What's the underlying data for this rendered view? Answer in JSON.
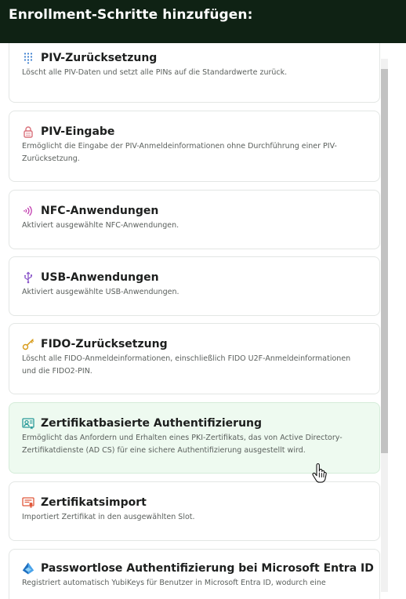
{
  "header": {
    "title": "Enrollment-Schritte hinzufügen:"
  },
  "steps": [
    {
      "icon": "keypad-icon",
      "title": "PIV-Zurücksetzung",
      "description": "Löscht alle PIV-Daten und setzt alle PINs auf die Standardwerte zurück."
    },
    {
      "icon": "lock-icon",
      "title": "PIV-Eingabe",
      "description": "Ermöglicht die Eingabe der PIV-Anmeldeinformationen ohne Durchführung einer PIV-Zurücksetzung."
    },
    {
      "icon": "nfc-icon",
      "title": "NFC-Anwendungen",
      "description": "Aktiviert ausgewählte NFC-Anwendungen."
    },
    {
      "icon": "usb-icon",
      "title": "USB-Anwendungen",
      "description": "Aktiviert ausgewählte USB-Anwendungen."
    },
    {
      "icon": "key-icon",
      "title": "FIDO-Zurücksetzung",
      "description": "Löscht alle FIDO-Anmeldeinformationen, einschließlich FIDO U2F-Anmeldeinformationen und die FIDO2-PIN."
    },
    {
      "icon": "certificate-icon",
      "title": "Zertifikatbasierte Authentifizierung",
      "description": "Ermöglicht das Anfordern und Erhalten eines PKI-Zertifikats, das von Active Directory-Zertifikatdienste (AD CS) für eine sichere Authentifizierung ausgestellt wird."
    },
    {
      "icon": "certificate-import-icon",
      "title": "Zertifikatsimport",
      "description": "Importiert Zertifikat in den ausgewählten Slot."
    },
    {
      "icon": "microsoft-entra-icon",
      "title": "Passwortlose Authentifizierung bei Microsoft Entra ID",
      "description": "Registriert automatisch YubiKeys für Benutzer in Microsoft Entra ID, wodurch eine"
    }
  ],
  "colors": {
    "header_bg": "#0f2214",
    "selected_card_bg": "#eefaf0",
    "keypad": "#3b7ecf",
    "lock": "#d9707a",
    "nfc": "#c23fb0",
    "usb": "#8a56c9",
    "key": "#d79a17",
    "certificate": "#2b9b9a",
    "certificate_import": "#e0573a",
    "entra": "#2a7fd0"
  }
}
